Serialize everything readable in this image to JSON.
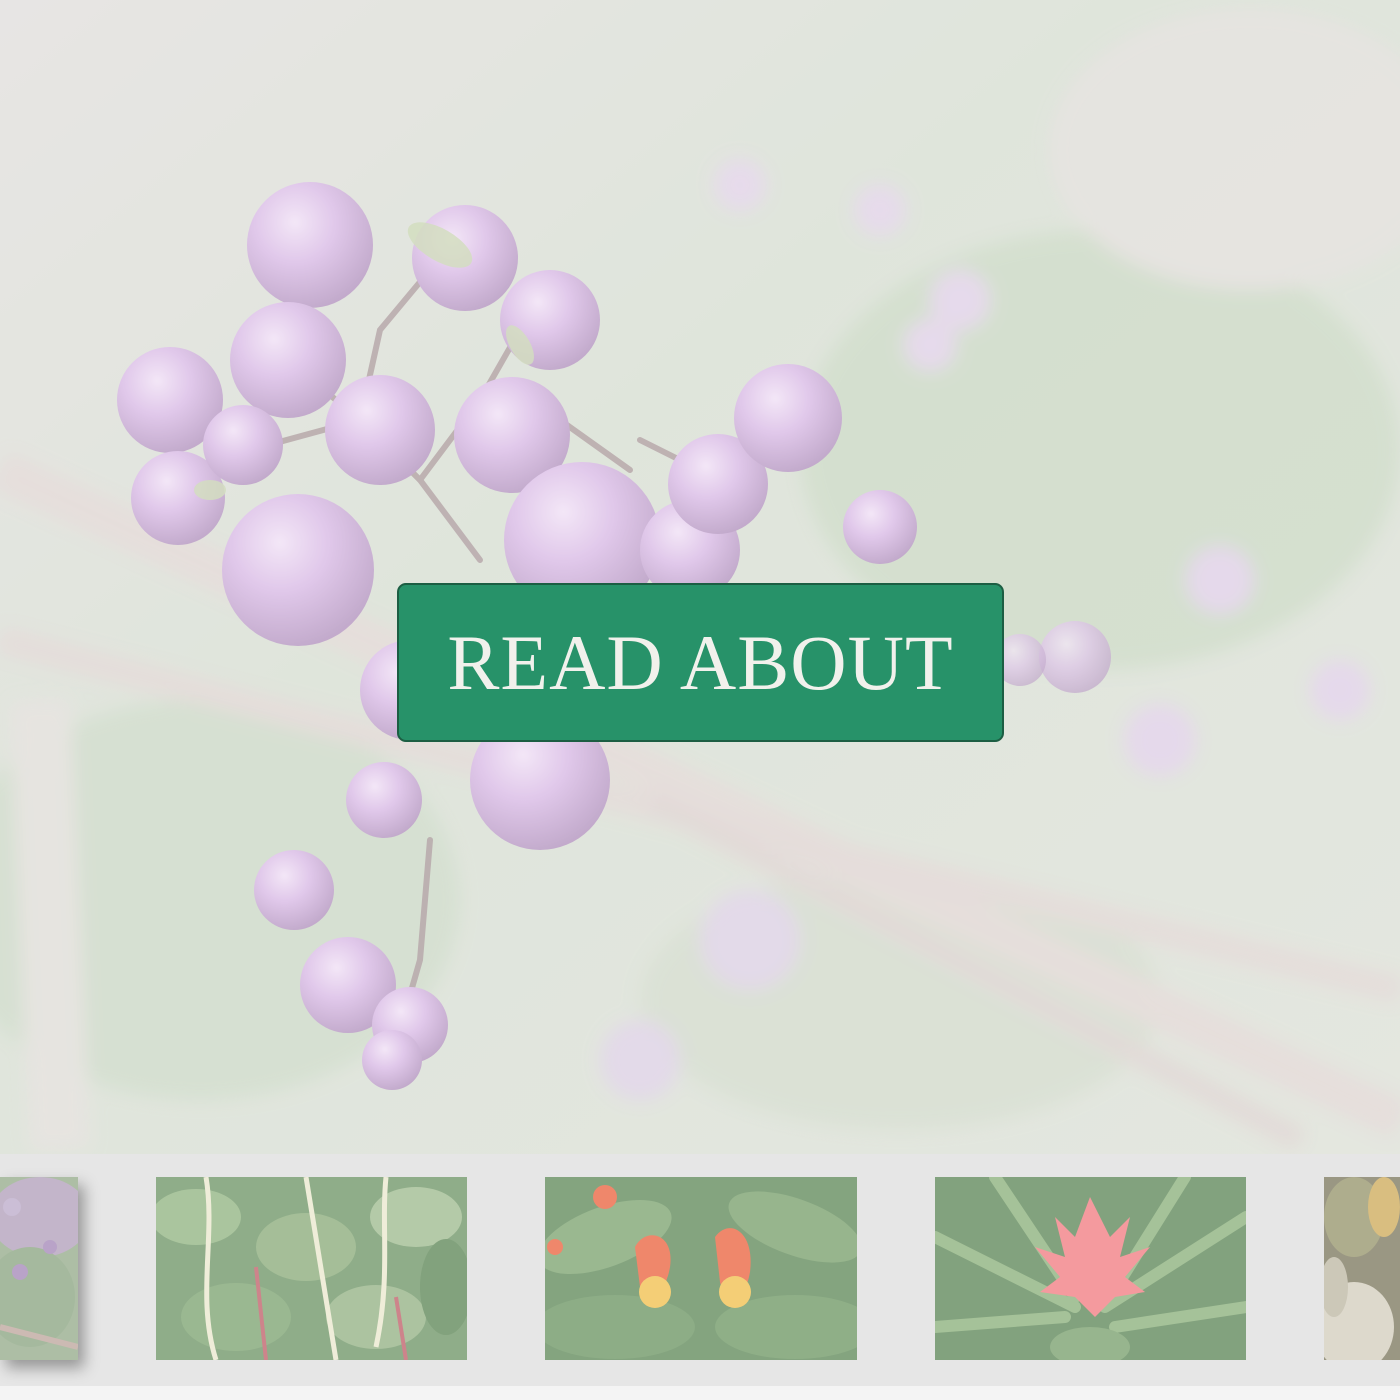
{
  "hero": {
    "button_label": "READ ABOUT",
    "image_subject": "purple-berries",
    "accent_color": "#279269"
  },
  "gallery": {
    "thumbnails": [
      {
        "subject": "purple-flowers"
      },
      {
        "subject": "green-leaves"
      },
      {
        "subject": "orange-flowers"
      },
      {
        "subject": "pink-bromeliad"
      },
      {
        "subject": "grass-plumes"
      }
    ]
  }
}
